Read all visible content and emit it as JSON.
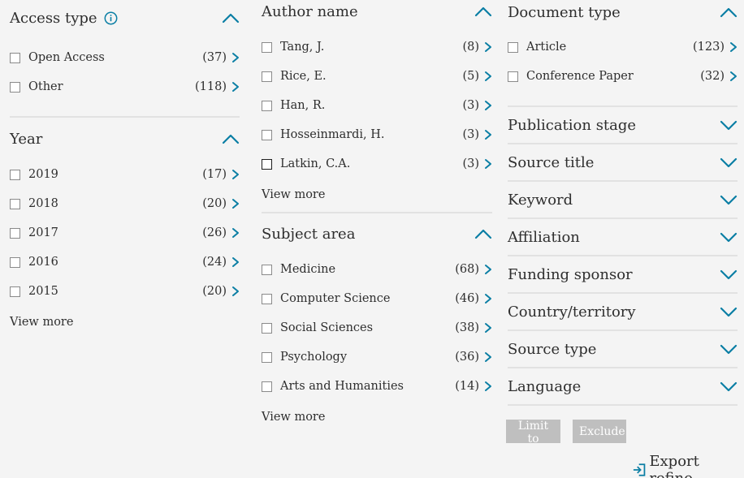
{
  "access_type": {
    "title": "Access type",
    "items": [
      {
        "label": "Open Access",
        "count": "(37)"
      },
      {
        "label": "Other",
        "count": "(118)"
      }
    ]
  },
  "year": {
    "title": "Year",
    "items": [
      {
        "label": "2019",
        "count": "(17)"
      },
      {
        "label": "2018",
        "count": "(20)"
      },
      {
        "label": "2017",
        "count": "(26)"
      },
      {
        "label": "2016",
        "count": "(24)"
      },
      {
        "label": "2015",
        "count": "(20)"
      }
    ],
    "view_more": "View more"
  },
  "author_name": {
    "title": "Author name",
    "items": [
      {
        "label": "Tang, J.",
        "count": "(8)"
      },
      {
        "label": "Rice, E.",
        "count": "(5)"
      },
      {
        "label": "Han, R.",
        "count": "(3)"
      },
      {
        "label": "Hosseinmardi, H.",
        "count": "(3)"
      },
      {
        "label": "Latkin, C.A.",
        "count": "(3)"
      }
    ],
    "view_more": "View more"
  },
  "subject_area": {
    "title": "Subject area",
    "items": [
      {
        "label": "Medicine",
        "count": "(68)"
      },
      {
        "label": "Computer Science",
        "count": "(46)"
      },
      {
        "label": "Social Sciences",
        "count": "(38)"
      },
      {
        "label": "Psychology",
        "count": "(36)"
      },
      {
        "label": "Arts and Humanities",
        "count": "(14)"
      }
    ],
    "view_more": "View more"
  },
  "document_type": {
    "title": "Document type",
    "items": [
      {
        "label": "Article",
        "count": "(123)"
      },
      {
        "label": "Conference Paper",
        "count": "(32)"
      }
    ]
  },
  "collapsed_sections": [
    "Publication stage",
    "Source title",
    "Keyword",
    "Affiliation",
    "Funding sponsor",
    "Country/territory",
    "Source type",
    "Language"
  ],
  "buttons": {
    "limit_to": "Limit to",
    "exclude": "Exclude"
  },
  "export_refine": "Export refine",
  "colors": {
    "accent": "#0a7ea4",
    "button_disabled": "#bfbfbf",
    "background": "#f4f4f4"
  },
  "icons": {
    "info": "info-icon",
    "expand": "chevron-down-icon",
    "collapse": "chevron-up-icon",
    "item": "chevron-right-icon",
    "export": "export-icon"
  }
}
